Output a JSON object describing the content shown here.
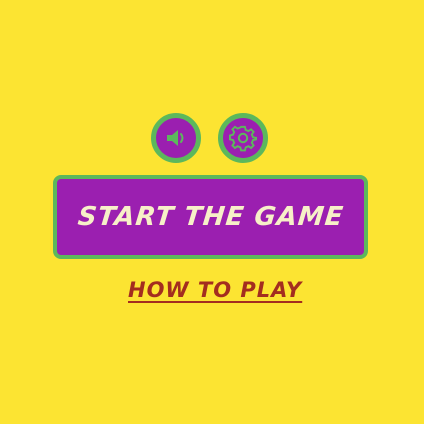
{
  "menu": {
    "start_label": "START THE GAME",
    "howto_label": "HOW TO PLAY"
  },
  "icons": {
    "sound": "speaker-icon",
    "settings": "gear-icon"
  },
  "colors": {
    "background": "#fce432",
    "button_fill": "#9b1fb0",
    "button_border": "#5cb85c",
    "start_text": "#f7f0c8",
    "howto_text": "#a32d1f",
    "icon_fill": "#9b1fb0",
    "icon_glyph": "#5cb85c"
  }
}
